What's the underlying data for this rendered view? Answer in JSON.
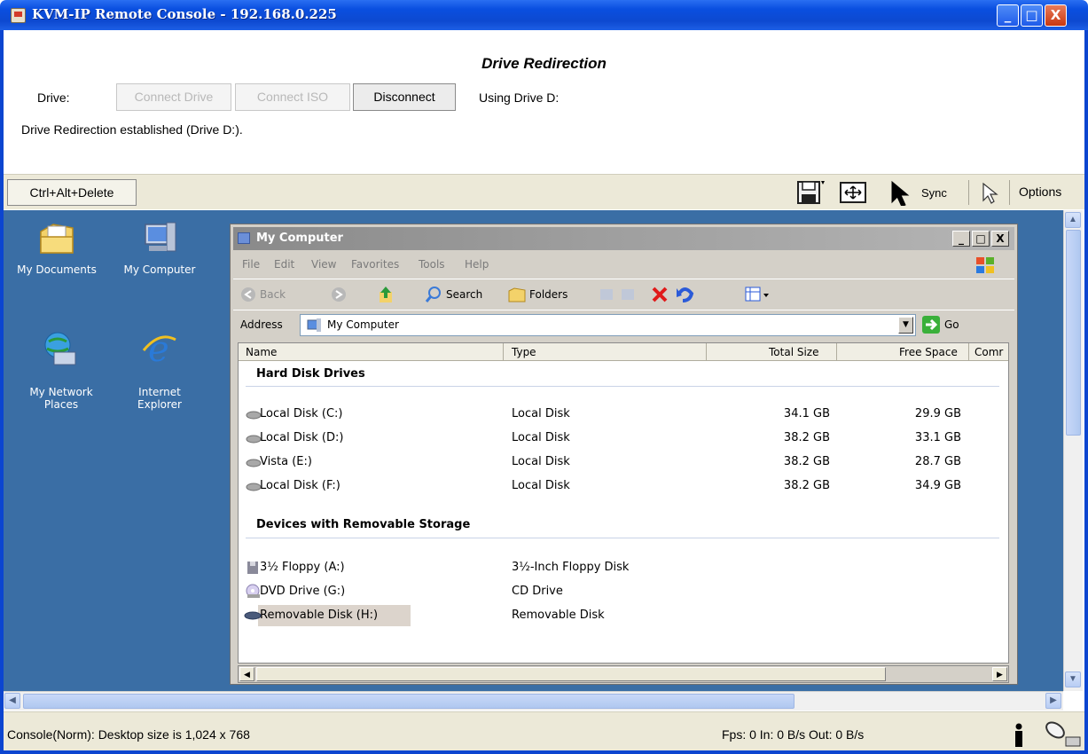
{
  "window": {
    "title": "KVM-IP Remote Console - 192.168.0.225",
    "controls": [
      "_",
      "□",
      "X"
    ]
  },
  "drive_panel": {
    "heading": "Drive Redirection",
    "drive_label": "Drive:",
    "connect_drive": "Connect Drive",
    "connect_iso": "Connect ISO",
    "disconnect": "Disconnect",
    "using_drive": "Using Drive D:",
    "status": "Drive Redirection established (Drive D:)."
  },
  "toolbar": {
    "cad_label": "Ctrl+Alt+Delete",
    "sync_label": "Sync",
    "options_label": "Options",
    "icons": [
      "floppy-icon",
      "fit-screen-icon",
      "arrow-cursor-icon",
      "pointer-icon"
    ]
  },
  "desktop": {
    "icons": [
      {
        "label": "My Documents",
        "icon": "folder-icon"
      },
      {
        "label": "My Computer",
        "icon": "computer-icon"
      },
      {
        "label": "My Network\nPlaces",
        "icon": "network-icon"
      },
      {
        "label": "Internet\nExplorer",
        "icon": "ie-icon"
      }
    ]
  },
  "explorer": {
    "title": "My Computer",
    "menu": [
      "File",
      "Edit",
      "View",
      "Favorites",
      "Tools",
      "Help"
    ],
    "toolbar": {
      "back": "Back",
      "search": "Search",
      "folders": "Folders"
    },
    "address_label": "Address",
    "address_value": "My Computer",
    "go_label": "Go",
    "columns": [
      "Name",
      "Type",
      "Total Size",
      "Free Space",
      "Comr"
    ],
    "groups": [
      {
        "name": "Hard Disk Drives",
        "items": [
          {
            "name": "Local Disk (C:)",
            "type": "Local Disk",
            "total": "34.1 GB",
            "free": "29.9 GB"
          },
          {
            "name": "Local Disk (D:)",
            "type": "Local Disk",
            "total": "38.2 GB",
            "free": "33.1 GB"
          },
          {
            "name": "Vista (E:)",
            "type": "Local Disk",
            "total": "38.2 GB",
            "free": "28.7 GB"
          },
          {
            "name": "Local Disk (F:)",
            "type": "Local Disk",
            "total": "38.2 GB",
            "free": "34.9 GB"
          }
        ]
      },
      {
        "name": "Devices with Removable Storage",
        "items": [
          {
            "name": "3½ Floppy (A:)",
            "type": "3½-Inch Floppy Disk",
            "total": "",
            "free": ""
          },
          {
            "name": "DVD Drive (G:)",
            "type": "CD Drive",
            "total": "",
            "free": ""
          },
          {
            "name": "Removable Disk (H:)",
            "type": "Removable Disk",
            "total": "",
            "free": ""
          }
        ]
      }
    ]
  },
  "status": {
    "left": "Console(Norm): Desktop size is 1,024 x 768",
    "right": "Fps: 0 In: 0 B/s Out: 0 B/s"
  },
  "colors": {
    "title_blue": "#0a4fe0",
    "desktop_blue": "#3a6ea5",
    "toolbar_beige": "#ece9d8"
  }
}
